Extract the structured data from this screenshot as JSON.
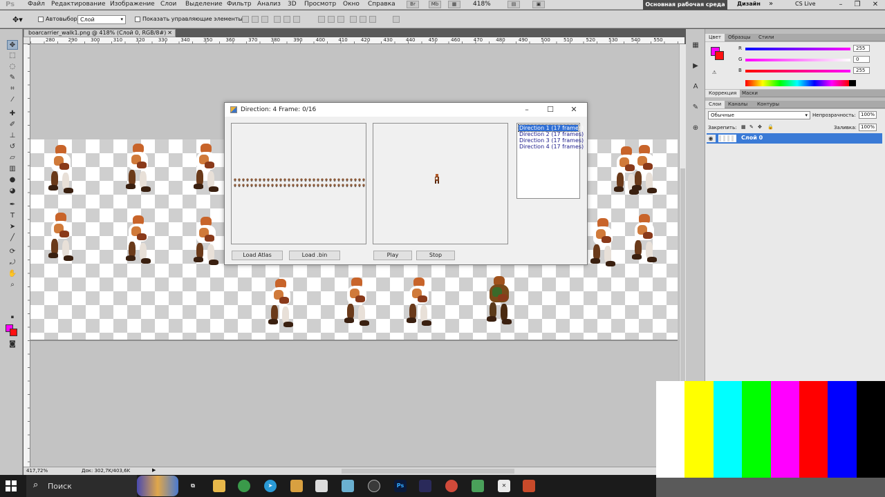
{
  "menubar": {
    "logo": "Ps",
    "items": [
      "Файл",
      "Редактирование",
      "Изображение",
      "Слои",
      "Выделение",
      "Фильтр",
      "Анализ",
      "3D",
      "Просмотр",
      "Окно",
      "Справка"
    ],
    "btn_br": "Br",
    "btn_mb": "Mb",
    "zoom": "418%",
    "workspace_essentials": "Основная рабочая среда",
    "workspace_design": "Дизайн",
    "more": "»",
    "cslive": "CS Live",
    "minimize": "–",
    "restore": "❐",
    "close": "✕"
  },
  "options": {
    "autoselect_label": "Автовыбор:",
    "autoselect_value": "Слой",
    "show_controls_label": "Показать управляющие элементы"
  },
  "document": {
    "tab_title": "boarcarrier_walk1.png @ 418% (Слой 0, RGB/8#)",
    "tab_close": "✕",
    "ruler_ticks": [
      "280",
      "290",
      "300",
      "310",
      "320",
      "330",
      "340",
      "350",
      "360",
      "370",
      "380",
      "390",
      "400",
      "410",
      "420",
      "430",
      "440",
      "450",
      "460",
      "470",
      "480",
      "490",
      "500",
      "510",
      "520",
      "530",
      "540",
      "550",
      "560"
    ],
    "status_zoom": "417,72%",
    "status_doc": "Док: 302,7K/403,6K",
    "status_arrow": "▶"
  },
  "panels": {
    "color_tabs": [
      "Цвет",
      "Образцы",
      "Стили"
    ],
    "r_label": "R",
    "g_label": "G",
    "b_label": "B",
    "r_value": "255",
    "g_value": "0",
    "b_value": "255",
    "correction_tabs": [
      "Коррекция",
      "Маски"
    ],
    "layers_tabs": [
      "Слои",
      "Каналы",
      "Контуры"
    ],
    "blend_mode": "Обычные",
    "opacity_label": "Непрозрачность:",
    "opacity_value": "100%",
    "lock_label": "Закрепить:",
    "fill_label": "Заливка:",
    "fill_value": "100%",
    "layer_name": "Слой 0"
  },
  "dialog": {
    "title": "Direction: 4 Frame: 0/16",
    "minimize": "–",
    "maximize": "☐",
    "close": "✕",
    "directions": [
      "Direction 1 (17 frames)",
      "Direction 2 (17 frames)",
      "Direction 3 (17 frames)",
      "Direction 4 (17 frames)"
    ],
    "load_atlas": "Load Atlas",
    "load_bin": "Load .bin",
    "play": "Play",
    "stop": "Stop"
  },
  "taskbar": {
    "search_placeholder": "Поиск",
    "ps_label": "Ps"
  },
  "colors": {
    "foreground": "#ff00ff",
    "background": "#ff1010",
    "selection": "#3a7ad6",
    "color_bars": [
      "#ffffff",
      "#ffff00",
      "#00ffff",
      "#00ff00",
      "#ff00ff",
      "#ff0000",
      "#0000ff",
      "#000000"
    ]
  }
}
